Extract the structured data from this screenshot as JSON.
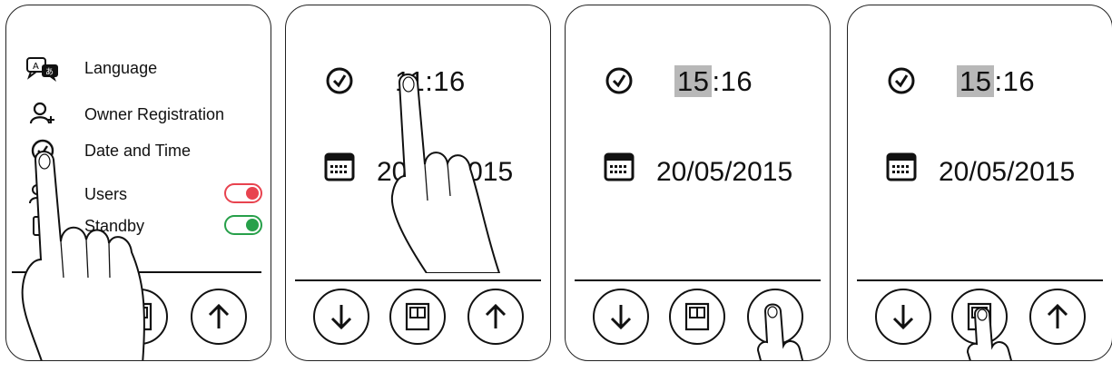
{
  "menu": {
    "items": [
      {
        "label": "Language",
        "icon": "language-icon"
      },
      {
        "label": "Owner Registration",
        "icon": "add-user-icon"
      },
      {
        "label": "Date and Time",
        "icon": "clock-icon"
      },
      {
        "label": "Users",
        "icon": "users-icon",
        "toggle": "on",
        "toggle_color": "#e8434f"
      },
      {
        "label": "Standby",
        "icon": "standby-icon",
        "toggle": "on",
        "toggle_color": "#27a04a"
      }
    ]
  },
  "screens": [
    {
      "time_hour": "11",
      "time_rest": ":16",
      "date": "20/05/2015"
    },
    {
      "time_hour": "15",
      "time_rest": ":16",
      "date": "20/05/2015"
    },
    {
      "time_hour": "15",
      "time_rest": ":16",
      "date": "20/05/2015"
    }
  ],
  "highlight_color": "#b8b8b8"
}
